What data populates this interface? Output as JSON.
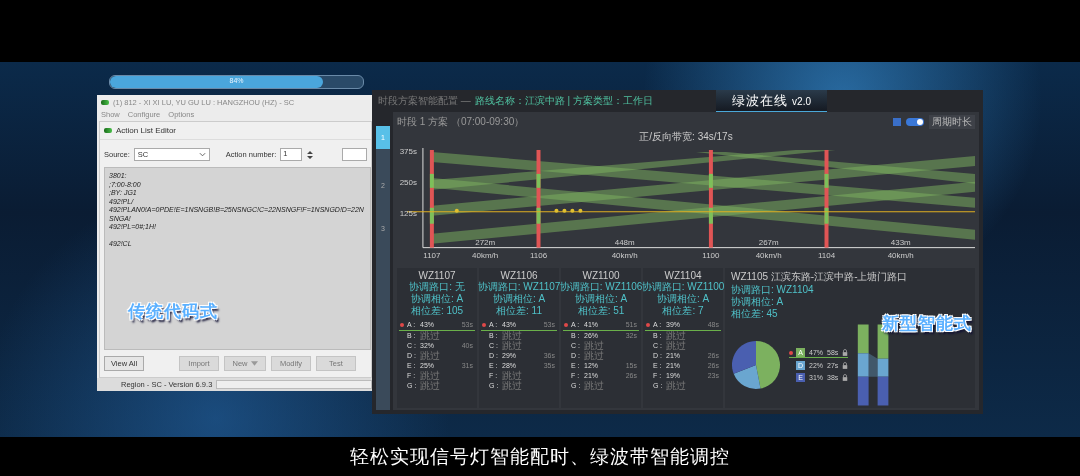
{
  "progress": {
    "level": 0.84,
    "reading": "84%"
  },
  "legacy_window": {
    "title": "(1)  812 - XI XI LU, YU GU LU : HANGZHOU (HZ) - SC",
    "menu": [
      "Show",
      "Configure",
      "Options"
    ],
    "dialog": {
      "title": "Action List Editor",
      "source_label": "Source:",
      "source_value": "SC",
      "action_label": "Action number:",
      "action_value": "1",
      "code_blocks": [
        [
          "3801:",
          ";7:00-8:00",
          ";BY: JG1",
          "492!PL/",
          "492!PLAN0!A=0PDE!E=1NSNGB!B=25NSNGC!C=22NSNGF!F=1NSNGD!D=22NSNGA!",
          "492!PL=0#;1H!"
        ],
        [
          "492!CL"
        ]
      ],
      "buttons": [
        {
          "label": "View All",
          "disabled": false,
          "kind": "plain"
        },
        {
          "label": "Import",
          "disabled": true,
          "kind": "plain"
        },
        {
          "label": "New",
          "disabled": true,
          "kind": "split"
        },
        {
          "label": "Modify",
          "disabled": true,
          "kind": "plain"
        },
        {
          "label": "Test",
          "disabled": true,
          "kind": "plain"
        }
      ]
    },
    "status": "Region - SC - Version 6.9.3"
  },
  "captions": [
    "传统代码式",
    "新型智能式"
  ],
  "dashboard": {
    "breadcrumb": "时段方案智能配置 —",
    "route": "路线名称：江滨中路 | 方案类型：工作日",
    "title": "绿波在线",
    "version": "v2.0",
    "side_tabs": [
      {
        "label": "1",
        "selected": true
      },
      {
        "label": "2",
        "selected": false
      },
      {
        "label": "3",
        "selected": false
      }
    ],
    "plan": "时段 1 方案 （07:00-09:30）",
    "toggle_on": true,
    "cycle_button": "周期时长",
    "chart_title": "正/反向带宽: 34s/17s",
    "y_labels": [
      "375s",
      "250s",
      "125s"
    ],
    "intersections": [
      "1107",
      "1106",
      "1100",
      "1104"
    ],
    "distances": [
      "272m",
      "448m",
      "267m",
      "433m"
    ],
    "speeds": [
      "40km/h",
      "40km/h",
      "40km/h",
      "40km/h"
    ],
    "cards": [
      {
        "id": "WZ1107",
        "coord": "协调路口: 无",
        "phase": "协调相位: A",
        "offset": "相位差: 105",
        "phases": [
          {
            "name": "A :",
            "share": "43%",
            "time": "53s",
            "coordinated": true
          },
          {
            "name": "B :",
            "share": "跳过",
            "coordinated": false
          },
          {
            "name": "C :",
            "share": "32%",
            "time": "40s",
            "coordinated": false
          },
          {
            "name": "D :",
            "share": "跳过",
            "coordinated": false
          },
          {
            "name": "E :",
            "share": "25%",
            "time": "31s",
            "coordinated": false
          },
          {
            "name": "F :",
            "share": "跳过",
            "coordinated": false
          },
          {
            "name": "G :",
            "share": "跳过",
            "coordinated": false
          }
        ]
      },
      {
        "id": "WZ1106",
        "coord": "协调路口: WZ1107",
        "phase": "协调相位: A",
        "offset": "相位差: 11",
        "phases": [
          {
            "name": "A :",
            "share": "43%",
            "time": "53s",
            "coordinated": true
          },
          {
            "name": "B :",
            "share": "跳过",
            "coordinated": false
          },
          {
            "name": "C :",
            "share": "跳过",
            "coordinated": false
          },
          {
            "name": "D :",
            "share": "29%",
            "time": "36s",
            "coordinated": false
          },
          {
            "name": "E :",
            "share": "28%",
            "time": "35s",
            "coordinated": false
          },
          {
            "name": "F :",
            "share": "跳过",
            "coordinated": false
          },
          {
            "name": "G :",
            "share": "跳过",
            "coordinated": false
          }
        ]
      },
      {
        "id": "WZ1100",
        "coord": "协调路口: WZ1106",
        "phase": "协调相位: A",
        "offset": "相位差: 51",
        "phases": [
          {
            "name": "A :",
            "share": "41%",
            "time": "51s",
            "coordinated": true
          },
          {
            "name": "B :",
            "share": "26%",
            "time": "32s",
            "coordinated": false
          },
          {
            "name": "C :",
            "share": "跳过",
            "coordinated": false
          },
          {
            "name": "D :",
            "share": "跳过",
            "coordinated": false
          },
          {
            "name": "E :",
            "share": "12%",
            "time": "15s",
            "coordinated": false
          },
          {
            "name": "F :",
            "share": "21%",
            "time": "26s",
            "coordinated": false
          },
          {
            "name": "G :",
            "share": "跳过",
            "coordinated": false
          }
        ]
      },
      {
        "id": "WZ1104",
        "coord": "协调路口: WZ1100",
        "phase": "协调相位: A",
        "offset": "相位差: 7",
        "phases": [
          {
            "name": "A :",
            "share": "39%",
            "time": "48s",
            "coordinated": true
          },
          {
            "name": "B :",
            "share": "跳过",
            "coordinated": false
          },
          {
            "name": "C :",
            "share": "跳过",
            "coordinated": false
          },
          {
            "name": "D :",
            "share": "21%",
            "time": "26s",
            "coordinated": false
          },
          {
            "name": "E :",
            "share": "21%",
            "time": "26s",
            "coordinated": false
          },
          {
            "name": "F :",
            "share": "19%",
            "time": "23s",
            "coordinated": false
          },
          {
            "name": "G :",
            "share": "跳过",
            "coordinated": false
          }
        ]
      }
    ],
    "summary": {
      "id": "WZ1105 江滨东路-江滨中路-上塘门路口",
      "coord": "协调路口: WZ1104",
      "phase": "协调相位: A",
      "offset": "相位差: 45",
      "legend": [
        {
          "share": "47%",
          "time": "58s",
          "color": "#7cb15f",
          "coordinated": true
        },
        {
          "share": "22%",
          "time": "27s",
          "color": "#6aa6d0",
          "coordinated": false
        },
        {
          "share": "31%",
          "time": "38s",
          "color": "#4a5fb0",
          "coordinated": false
        }
      ],
      "chart_data": {
        "type": "pie",
        "categories": [
          "A",
          "D",
          "E"
        ],
        "values": [
          47,
          22,
          31
        ]
      }
    }
  },
  "subtitle": "轻松实现信号灯智能配时、绿波带智能调控"
}
